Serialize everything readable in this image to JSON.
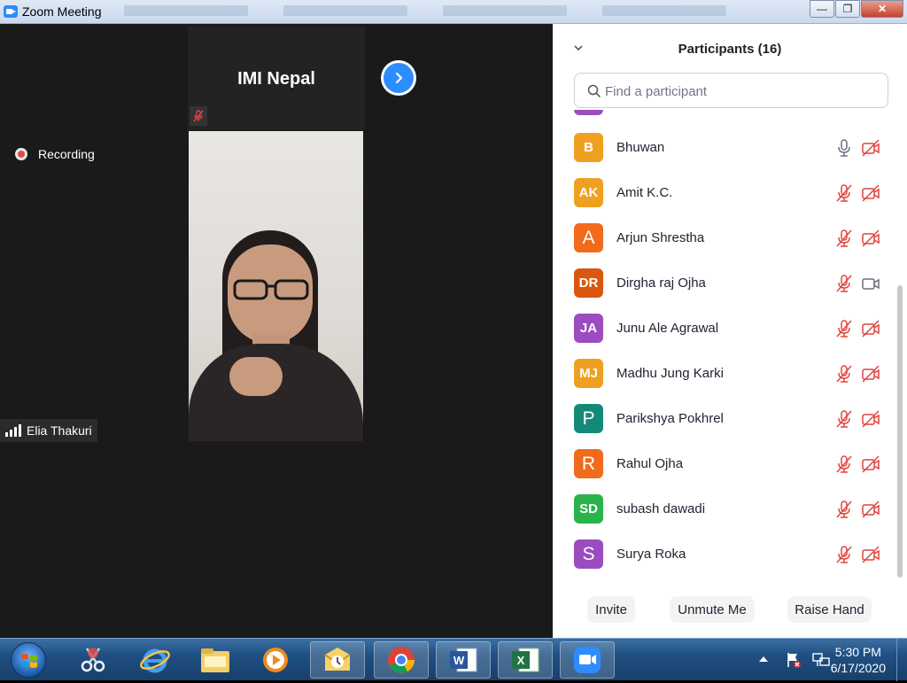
{
  "window": {
    "title": "Zoom Meeting",
    "controls": {
      "minimize": "—",
      "restore": "❐",
      "close": "✕"
    }
  },
  "meeting": {
    "recording_label": "Recording",
    "host_tile_name": "IMI Nepal",
    "active_speaker_name": "Elia Thakuri"
  },
  "participants_panel": {
    "title": "Participants (16)",
    "search_placeholder": "Find a participant",
    "participants": [
      {
        "initials": "B",
        "name": "Bhuwan",
        "color": "#f0a020",
        "mic": "on",
        "video": "off"
      },
      {
        "initials": "AK",
        "name": "Amit K.C.",
        "color": "#f0a020",
        "mic": "muted",
        "video": "off"
      },
      {
        "initials": "A",
        "name": "Arjun Shrestha",
        "color": "#f26a1b",
        "mic": "muted",
        "video": "off"
      },
      {
        "initials": "DR",
        "name": "Dirgha raj Ojha",
        "color": "#d9570f",
        "mic": "muted",
        "video": "on"
      },
      {
        "initials": "JA",
        "name": "Junu Ale Agrawal",
        "color": "#9b4cc0",
        "mic": "muted",
        "video": "off"
      },
      {
        "initials": "MJ",
        "name": "Madhu Jung Karki",
        "color": "#f0a020",
        "mic": "muted",
        "video": "off"
      },
      {
        "initials": "P",
        "name": "Parikshya Pokhrel",
        "color": "#138a78",
        "mic": "muted",
        "video": "off"
      },
      {
        "initials": "R",
        "name": "Rahul Ojha",
        "color": "#f26a1b",
        "mic": "muted",
        "video": "off"
      },
      {
        "initials": "SD",
        "name": "subash dawadi",
        "color": "#2bb34b",
        "mic": "muted",
        "video": "off"
      },
      {
        "initials": "S",
        "name": "Surya Roka",
        "color": "#9b4cc0",
        "mic": "muted",
        "video": "off"
      }
    ],
    "footer": {
      "invite": "Invite",
      "unmute": "Unmute Me",
      "raise_hand": "Raise Hand"
    }
  },
  "taskbar": {
    "time": "5:30 PM",
    "date": "6/17/2020",
    "apps": [
      "start-orb",
      "snipping-tool-icon",
      "internet-explorer-icon",
      "file-explorer-icon",
      "media-player-icon",
      "outlook-icon",
      "chrome-icon",
      "word-icon",
      "excel-icon",
      "zoom-icon"
    ]
  }
}
